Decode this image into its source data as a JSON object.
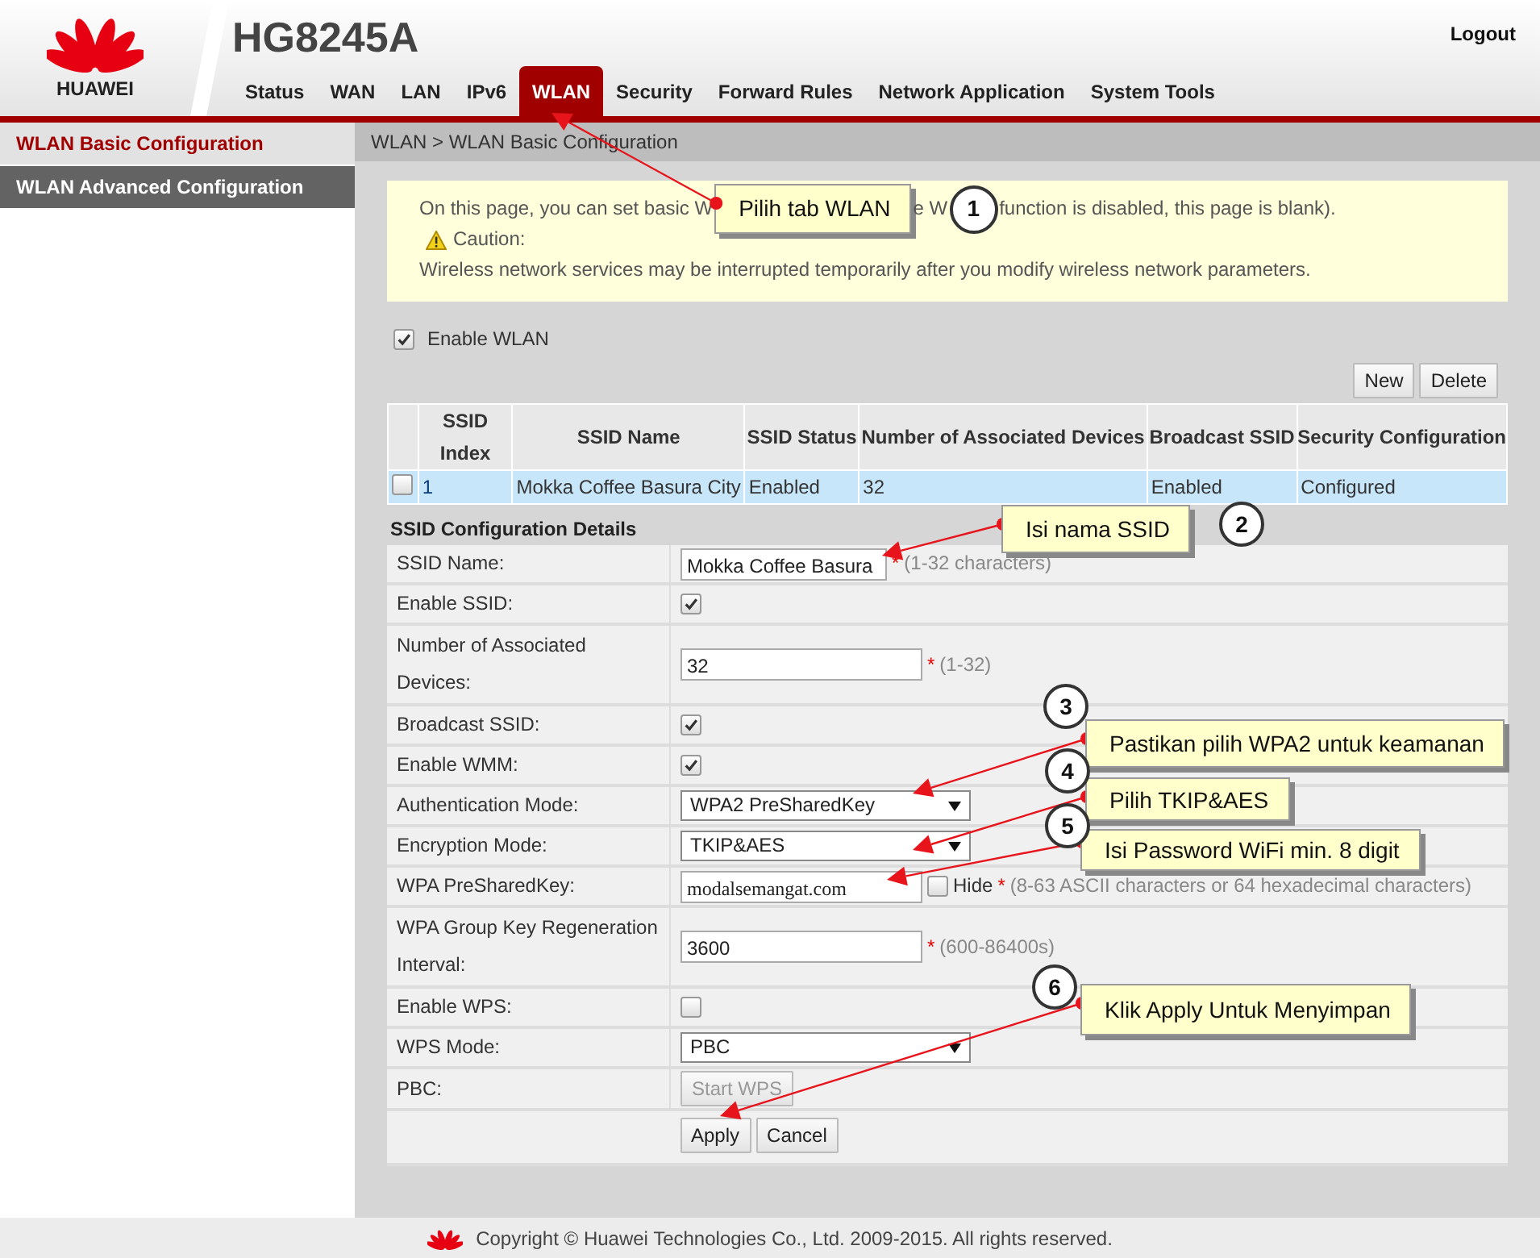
{
  "header": {
    "brand": "HUAWEI",
    "model": "HG8245A",
    "logout": "Logout",
    "tabs": [
      {
        "label": "Status",
        "selected": false
      },
      {
        "label": "WAN",
        "selected": false
      },
      {
        "label": "LAN",
        "selected": false
      },
      {
        "label": "IPv6",
        "selected": false
      },
      {
        "label": "WLAN",
        "selected": true
      },
      {
        "label": "Security",
        "selected": false
      },
      {
        "label": "Forward Rules",
        "selected": false
      },
      {
        "label": "Network Application",
        "selected": false
      },
      {
        "label": "System Tools",
        "selected": false
      }
    ]
  },
  "sidebar": {
    "items": [
      {
        "label": "WLAN Basic Configuration",
        "selected": true
      },
      {
        "label": "WLAN Advanced Configuration",
        "selected": false
      }
    ]
  },
  "breadcrumb": "WLAN > WLAN Basic Configuration",
  "notice": {
    "line_1_parts": [
      "On this page, you can set basic W",
      "e W",
      "function is disabled, this page is blank)."
    ],
    "caution": "Caution:",
    "line_2": "Wireless network services may be interrupted temporarily after you modify wireless network parameters."
  },
  "enable_wlan": {
    "label": "Enable WLAN",
    "checked": true
  },
  "table_buttons": [
    "New",
    "Delete"
  ],
  "table": {
    "columns": [
      "SSID Index",
      "SSID Name",
      "SSID Status",
      "Number of Associated Devices",
      "Broadcast SSID",
      "Security Configuration"
    ],
    "rows": [
      {
        "checked": false,
        "selected": true,
        "cells": [
          "1",
          "Mokka Coffee Basura City",
          "Enabled",
          "32",
          "Enabled",
          "Configured"
        ]
      }
    ]
  },
  "details": {
    "title": "SSID Configuration Details",
    "fields": [
      {
        "kind": "text",
        "label": "SSID Name:",
        "value": "Mokka Coffee Basura",
        "mark": "*",
        "hint": "(1-32 characters)"
      },
      {
        "kind": "checkbox",
        "label": "Enable SSID:",
        "checked": true
      },
      {
        "kind": "text",
        "label": "Number of Associated Devices:",
        "value": "32",
        "mark": "*",
        "hint": "(1-32)"
      },
      {
        "kind": "checkbox",
        "label": "Broadcast SSID:",
        "checked": true
      },
      {
        "kind": "checkbox",
        "label": "Enable WMM:",
        "checked": true
      },
      {
        "kind": "select",
        "label": "Authentication Mode:",
        "value": "WPA2 PreSharedKey"
      },
      {
        "kind": "select",
        "label": "Encryption Mode:",
        "value": "TKIP&AES"
      },
      {
        "kind": "password",
        "label": "WPA PreSharedKey:",
        "value": "modalsemangat.com",
        "hide_checked": false,
        "hide_label": "Hide",
        "mark": "*",
        "hint": "(8-63 ASCII characters or 64 hexadecimal characters)"
      },
      {
        "kind": "text",
        "label": "WPA Group Key Regeneration Interval:",
        "value": "3600",
        "mark": "*",
        "hint": "(600-86400s)"
      },
      {
        "kind": "checkbox",
        "label": "Enable WPS:",
        "checked": false
      },
      {
        "kind": "select",
        "label": "WPS Mode:",
        "value": "PBC"
      },
      {
        "kind": "button",
        "label": "PBC:",
        "value": "Start WPS",
        "disabled": true
      }
    ]
  },
  "action_buttons": [
    "Apply",
    "Cancel"
  ],
  "callouts": [
    {
      "number": "1",
      "text": "Pilih tab WLAN"
    },
    {
      "number": "2",
      "text": "Isi nama SSID"
    },
    {
      "number": "3",
      "text": "Pastikan pilih WPA2 untuk keamanan"
    },
    {
      "number": "4",
      "text": "Pilih TKIP&AES"
    },
    {
      "number": "5",
      "text": "Isi Password WiFi min. 8 digit"
    },
    {
      "number": "6",
      "text": "Klik Apply Untuk Menyimpan"
    }
  ],
  "footer": "Copyright © Huawei Technologies Co., Ltd. 2009-2015. All rights reserved."
}
